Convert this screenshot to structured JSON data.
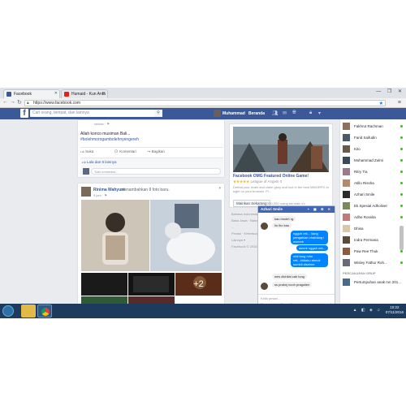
{
  "browser": {
    "tabs": [
      {
        "label": "Facebook",
        "favicon_color": "#3b5998"
      },
      {
        "label": "Humaid - Kun Anta",
        "favicon_color": "#e62117"
      }
    ],
    "url": "https://www.facebook.com",
    "controls": "— ❐ ✕"
  },
  "fb": {
    "logo": "f",
    "search_placeholder": "Cari orang, tempat, dan lainnya",
    "user_name": "Muhammad",
    "home_label": "Beranda"
  },
  "post1": {
    "meta": "sekitar · ⚑",
    "text1": "Allah konco musiman Bali...",
    "text2": "#bolehmorogambolehnyengereh",
    "actions": [
      "Suka",
      "Komentari",
      "Bagikan"
    ],
    "likes": "Lala dan 8 lainnya",
    "comment_placeholder": "Tulis komentar..."
  },
  "post2": {
    "author": "Rinima Wahyuni",
    "action": "menambahkan 8 foto baru.",
    "time": "9 jam · ⚑",
    "more_count": "+2"
  },
  "ad": {
    "title": "Facebook OMG Featured Online Game!",
    "stars": "★★★★★",
    "game": "League of Angels II",
    "description": "Defeat your rivals and claim glory and loot in the best MMORPG in sight on your browser. Pl...",
    "button": "Mainkan Sekarang",
    "note": "350,000 orang bermain ini"
  },
  "footer": {
    "lines": [
      "Bahasa Indonesia · English (US)",
      "Basa Jawa · Bahasa Melayu",
      "...",
      "Privasi · Ketentuan · Iklan",
      "Lainnya ▾",
      "Facebook © 2016"
    ]
  },
  "chat": {
    "name": "Azhari Smile",
    "controls": "+ ▣ ⚙ ✕",
    "messages": [
      {
        "dir": "in",
        "text": "kau mode\\ rg"
      },
      {
        "dir": "in",
        "text": "ilo lho kau"
      },
      {
        "dir": "out",
        "text": "ngguh rek... ilang pengahian chatdang i wonrek"
      },
      {
        "dir": "out",
        "text": "aseek nggah rek..."
      },
      {
        "dir": "out",
        "text": "mbl tang mhe rek...kitdaku ahnoil sumbil diselme"
      },
      {
        "dir": "in",
        "text": "wes dichilat cah lung"
      },
      {
        "dir": "in",
        "text": "ss praknj ncoh pragulien"
      }
    ],
    "input_placeholder": "Ketik pesan...",
    "tools": "▣ ☺ ⊞ ◫ ♥ ⊙"
  },
  "contacts": {
    "items": [
      {
        "name": "Fakhrut Rachman",
        "online": true
      },
      {
        "name": "Farid Saifudin",
        "online": true
      },
      {
        "name": "Kito",
        "online": true
      },
      {
        "name": "Mohammad Zulmi",
        "online": true
      },
      {
        "name": "Ritry Tia",
        "online": true
      },
      {
        "name": "Atillo Rissha",
        "online": true
      },
      {
        "name": "Azhari Smile",
        "online": true
      },
      {
        "name": "Ek Spesial Adholiver",
        "online": true
      },
      {
        "name": "Adhe Rossita",
        "online": true
      },
      {
        "name": "Dhisa",
        "online": true
      },
      {
        "name": "Indra Permana",
        "online": true
      },
      {
        "name": "Paw Ree Thuk",
        "online": true
      },
      {
        "name": "Wisley Fathur Roh...",
        "online": true
      }
    ],
    "heading": "PERCAKAPAN GRUP",
    "group_item": "Pertumpuhan anak mn 201...",
    "search_placeholder": "Cari"
  },
  "taskbar": {
    "tray": "▲ ◧ ◈ ♫",
    "time": "10:22",
    "date": "07/11/2016"
  }
}
